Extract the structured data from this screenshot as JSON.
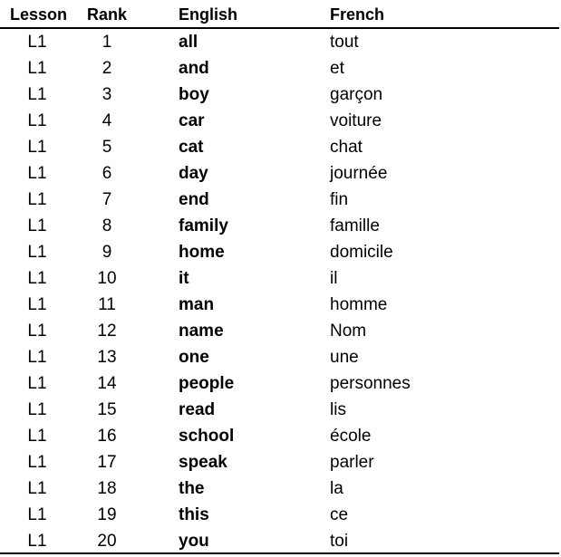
{
  "table": {
    "headers": {
      "lesson": "Lesson",
      "rank": "Rank",
      "english": "English",
      "french": "French"
    },
    "rows": [
      {
        "lesson": "L1",
        "rank": "1",
        "english": "all",
        "french": "tout"
      },
      {
        "lesson": "L1",
        "rank": "2",
        "english": "and",
        "french": "et"
      },
      {
        "lesson": "L1",
        "rank": "3",
        "english": "boy",
        "french": "garçon"
      },
      {
        "lesson": "L1",
        "rank": "4",
        "english": "car",
        "french": "voiture"
      },
      {
        "lesson": "L1",
        "rank": "5",
        "english": "cat",
        "french": "chat"
      },
      {
        "lesson": "L1",
        "rank": "6",
        "english": "day",
        "french": "journée"
      },
      {
        "lesson": "L1",
        "rank": "7",
        "english": "end",
        "french": "fin"
      },
      {
        "lesson": "L1",
        "rank": "8",
        "english": "family",
        "french": "famille"
      },
      {
        "lesson": "L1",
        "rank": "9",
        "english": "home",
        "french": "domicile"
      },
      {
        "lesson": "L1",
        "rank": "10",
        "english": "it",
        "french": "il"
      },
      {
        "lesson": "L1",
        "rank": "11",
        "english": "man",
        "french": "homme"
      },
      {
        "lesson": "L1",
        "rank": "12",
        "english": "name",
        "french": "Nom"
      },
      {
        "lesson": "L1",
        "rank": "13",
        "english": "one",
        "french": "une"
      },
      {
        "lesson": "L1",
        "rank": "14",
        "english": "people",
        "french": "personnes"
      },
      {
        "lesson": "L1",
        "rank": "15",
        "english": "read",
        "french": "lis"
      },
      {
        "lesson": "L1",
        "rank": "16",
        "english": "school",
        "french": "école"
      },
      {
        "lesson": "L1",
        "rank": "17",
        "english": "speak",
        "french": "parler"
      },
      {
        "lesson": "L1",
        "rank": "18",
        "english": "the",
        "french": "la"
      },
      {
        "lesson": "L1",
        "rank": "19",
        "english": "this",
        "french": "ce"
      },
      {
        "lesson": "L1",
        "rank": "20",
        "english": "you",
        "french": "toi"
      }
    ]
  }
}
